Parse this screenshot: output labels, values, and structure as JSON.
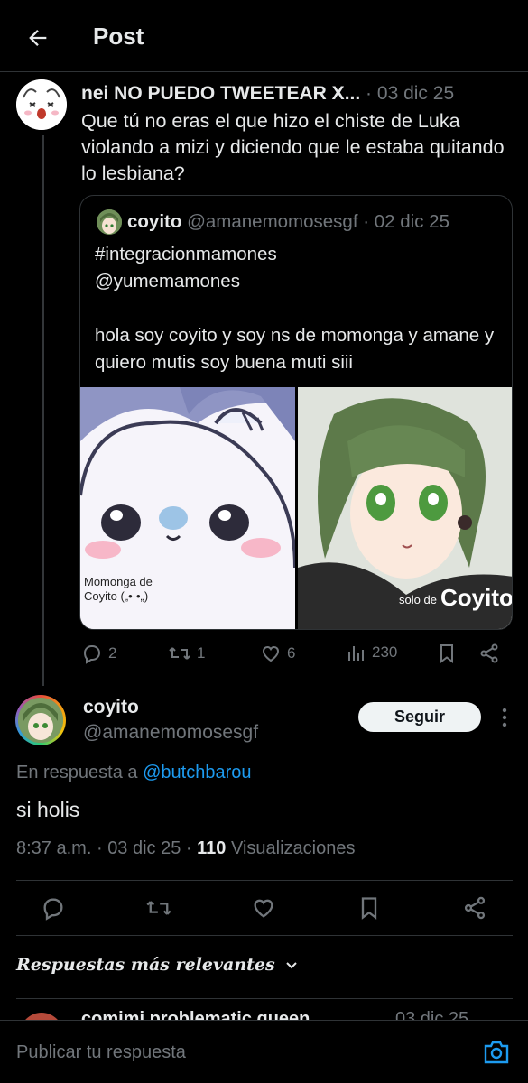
{
  "header": {
    "title": "Post",
    "back_icon": "arrow-left-icon"
  },
  "parent_tweet": {
    "name": "nei NO PUEDO TWEETEAR X...",
    "separator": "·",
    "date": "03 dic 25",
    "text": "Que tú no eras el que hizo el chiste de Luka violando a mizi y diciendo que le estaba quitando lo lesbiana?",
    "quote": {
      "name": "coyito",
      "handle": "@amanemomosesgf",
      "separator": "·",
      "date": "02 dic 25",
      "line1": "#integracionmamones",
      "line2": "@yumemamones",
      "line3": "hola soy coyito y soy ns de momonga y amane y quiero mutis soy buena muti siii",
      "image1_caption_1": "Momonga   de",
      "image1_caption_2": "Coyito („•-•„)",
      "image2_caption_small": "solo de",
      "image2_caption_big": "Coyito"
    },
    "actions": {
      "replies": "2",
      "reposts": "1",
      "likes": "6",
      "views": "230"
    }
  },
  "main_tweet": {
    "name": "coyito",
    "handle": "@amanemomosesgf",
    "follow_label": "Seguir",
    "reply_prefix": "En respuesta a",
    "reply_handle": "@butchbarou",
    "text": "si holis",
    "time": "8:37 a.m.",
    "date": "03 dic 25",
    "dot": "·",
    "views_count": "110",
    "views_label": "Visualizaciones"
  },
  "replies_section": {
    "label": "Respuestas más relevantes",
    "next_name": "comimi problematic queen",
    "next_date": "03 dic 25"
  },
  "compose": {
    "placeholder": "Publicar tu respuesta",
    "camera_icon": "camera-icon"
  },
  "colors": {
    "background": "#000000",
    "text": "#e7e9ea",
    "muted": "#71767b",
    "link": "#1d9bf0",
    "border": "#2f3336",
    "follow_button_bg": "#eff3f4"
  }
}
